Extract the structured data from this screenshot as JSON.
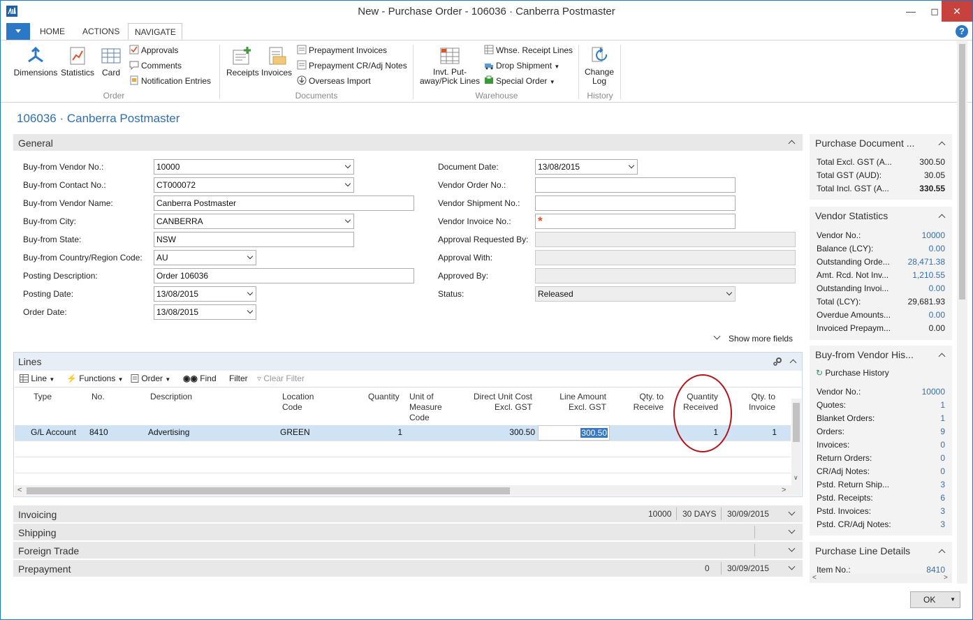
{
  "window": {
    "title": "New - Purchase Order - 106036 · Canberra Postmaster"
  },
  "ribbon": {
    "tabs": [
      {
        "label": "HOME"
      },
      {
        "label": "ACTIONS"
      },
      {
        "label": "NAVIGATE"
      }
    ],
    "order": {
      "dimensions": "Dimensions",
      "statistics": "Statistics",
      "card": "Card",
      "approvals": "Approvals",
      "comments": "Comments",
      "notification_entries": "Notification Entries",
      "group": "Order"
    },
    "documents": {
      "receipts": "Receipts",
      "invoices": "Invoices",
      "prepayment_invoices": "Prepayment Invoices",
      "prepayment_cr_adj": "Prepayment CR/Adj Notes",
      "overseas_import": "Overseas Import",
      "group": "Documents"
    },
    "warehouse": {
      "invt_put_1": "Invt. Put-",
      "invt_put_2": "away/Pick Lines",
      "whse_receipt": "Whse. Receipt Lines",
      "drop_shipment": "Drop Shipment",
      "special_order": "Special Order",
      "group": "Warehouse"
    },
    "history": {
      "change_1": "Change",
      "change_2": "Log",
      "group": "History"
    }
  },
  "page_title": "106036 · Canberra Postmaster",
  "general": {
    "title": "General",
    "left": [
      {
        "label": "Buy-from Vendor No.:",
        "value": "10000"
      },
      {
        "label": "Buy-from Contact No.:",
        "value": "CT000072"
      },
      {
        "label": "Buy-from Vendor Name:",
        "value": "Canberra Postmaster"
      },
      {
        "label": "Buy-from City:",
        "value": "CANBERRA"
      },
      {
        "label": "Buy-from State:",
        "value": "NSW"
      },
      {
        "label": "Buy-from Country/Region Code:",
        "value": "AU"
      },
      {
        "label": "Posting Description:",
        "value": "Order 106036"
      },
      {
        "label": "Posting Date:",
        "value": "13/08/2015"
      },
      {
        "label": "Order Date:",
        "value": "13/08/2015"
      }
    ],
    "right": [
      {
        "label": "Document Date:",
        "value": "13/08/2015"
      },
      {
        "label": "Vendor Order No.:",
        "value": ""
      },
      {
        "label": "Vendor Shipment No.:",
        "value": ""
      },
      {
        "label": "Vendor Invoice No.:",
        "value": ""
      },
      {
        "label": "Approval Requested By:",
        "value": ""
      },
      {
        "label": "Approval With:",
        "value": ""
      },
      {
        "label": "Approved By:",
        "value": ""
      },
      {
        "label": "Status:",
        "value": "Released"
      }
    ],
    "show_more": "Show more fields"
  },
  "lines": {
    "title": "Lines",
    "toolbar": {
      "line": "Line",
      "functions": "Functions",
      "order": "Order",
      "find": "Find",
      "filter": "Filter",
      "clear_filter": "Clear Filter"
    },
    "columns": {
      "type": "Type",
      "no": "No.",
      "description": "Description",
      "location_1": "Location",
      "location_2": "Code",
      "quantity": "Quantity",
      "uom_1": "Unit of",
      "uom_2": "Measure",
      "uom_3": "Code",
      "ducost_1": "Direct Unit Cost",
      "ducost_2": "Excl. GST",
      "lineamt_1": "Line Amount",
      "lineamt_2": "Excl. GST",
      "qtyrec_1": "Qty. to",
      "qtyrec_2": "Receive",
      "qtyreceived_1": "Quantity",
      "qtyreceived_2": "Received",
      "qtyinv_1": "Qty. to",
      "qtyinv_2": "Invoice"
    },
    "row": {
      "type": "G/L Account",
      "no": "8410",
      "description": "Advertising",
      "location": "GREEN",
      "quantity": "1",
      "direct_unit_cost": "300.50",
      "line_amount": "300.50",
      "qty_received": "1",
      "qty_to_invoice": "1"
    }
  },
  "sections": {
    "invoicing": {
      "title": "Invoicing",
      "v1": "10000",
      "v2": "30 DAYS",
      "v3": "30/09/2015"
    },
    "shipping": {
      "title": "Shipping"
    },
    "foreign_trade": {
      "title": "Foreign Trade"
    },
    "prepayment": {
      "title": "Prepayment",
      "v1": "0",
      "v2": "30/09/2015"
    }
  },
  "factbox_doc": {
    "title": "Purchase Document ...",
    "rows": [
      {
        "label": "Total Excl. GST (A...",
        "value": "300.50"
      },
      {
        "label": "Total GST (AUD):",
        "value": "30.05"
      },
      {
        "label": "Total Incl. GST (A...",
        "value": "330.55"
      }
    ]
  },
  "factbox_vendor": {
    "title": "Vendor Statistics",
    "rows": [
      {
        "label": "Vendor No.:",
        "value": "10000"
      },
      {
        "label": "Balance (LCY):",
        "value": "0.00"
      },
      {
        "label": "Outstanding Orde...",
        "value": "28,471.38"
      },
      {
        "label": "Amt. Rcd. Not Inv...",
        "value": "1,210.55"
      },
      {
        "label": "Outstanding Invoi...",
        "value": "0.00"
      },
      {
        "label": "Total (LCY):",
        "value": "29,681.93"
      },
      {
        "label": "Overdue Amounts...",
        "value": "0.00"
      },
      {
        "label": "Invoiced Prepaym...",
        "value": "0.00"
      }
    ]
  },
  "factbox_history": {
    "title": "Buy-from Vendor His...",
    "link": "Purchase History",
    "rows": [
      {
        "label": "Vendor No.:",
        "value": "10000"
      },
      {
        "label": "Quotes:",
        "value": "1"
      },
      {
        "label": "Blanket Orders:",
        "value": "1"
      },
      {
        "label": "Orders:",
        "value": "9"
      },
      {
        "label": "Invoices:",
        "value": "0"
      },
      {
        "label": "Return Orders:",
        "value": "0"
      },
      {
        "label": "CR/Adj Notes:",
        "value": "0"
      },
      {
        "label": "Pstd. Return Ship...",
        "value": "3"
      },
      {
        "label": "Pstd. Receipts:",
        "value": "6"
      },
      {
        "label": "Pstd. Invoices:",
        "value": "3"
      },
      {
        "label": "Pstd. CR/Adj Notes:",
        "value": "3"
      }
    ]
  },
  "factbox_line": {
    "title": "Purchase Line Details",
    "rows": [
      {
        "label": "Item No.:",
        "value": "8410"
      }
    ]
  },
  "ok": "OK",
  "colors": {
    "accent": "#2b78c6",
    "link": "#2f6fb0",
    "annotation": "#b3141b",
    "selection": "#cfe3f5"
  }
}
